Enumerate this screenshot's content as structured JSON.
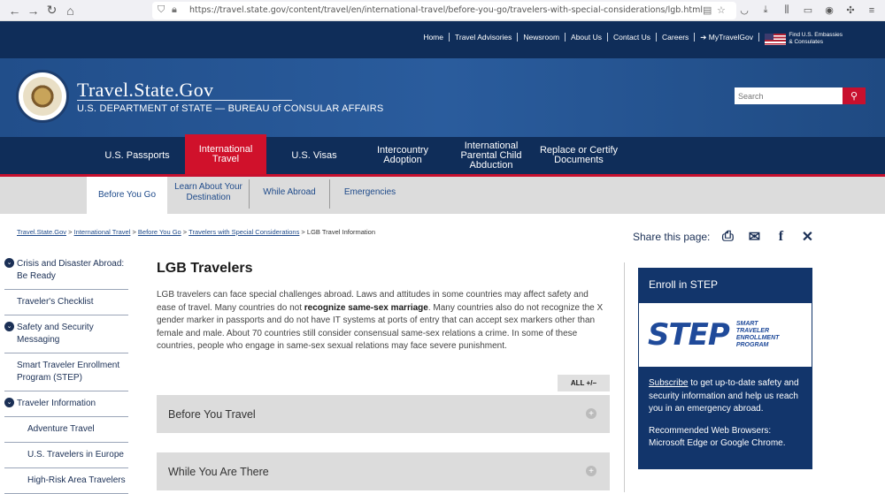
{
  "browser": {
    "url": "https://travel.state.gov/content/travel/en/international-travel/before-you-go/travelers-with-special-considerations/lgb.html"
  },
  "utility": {
    "links": [
      "Home",
      "Travel Advisories",
      "Newsroom",
      "About Us",
      "Contact Us",
      "Careers",
      "MyTravelGov"
    ],
    "embassy_line1": "Find U.S. Embassies",
    "embassy_line2": "& Consulates"
  },
  "header": {
    "title": "Travel.State.Gov",
    "subtitle": "U.S. DEPARTMENT of STATE — BUREAU of CONSULAR AFFAIRS",
    "search_placeholder": "Search"
  },
  "main_nav": [
    {
      "label": "U.S. Passports"
    },
    {
      "label": "International Travel"
    },
    {
      "label": "U.S. Visas"
    },
    {
      "label": "Intercountry Adoption"
    },
    {
      "label": "International Parental Child Abduction"
    },
    {
      "label": "Replace or Certify Documents"
    }
  ],
  "sub_nav": [
    {
      "label": "Before You Go"
    },
    {
      "label": "Learn About Your Destination"
    },
    {
      "label": "While Abroad"
    },
    {
      "label": "Emergencies"
    }
  ],
  "breadcrumb": {
    "items": [
      "Travel.State.Gov",
      "International Travel",
      "Before You Go",
      "Travelers with Special Considerations"
    ],
    "current": "LGB Travel Information"
  },
  "share": {
    "label": "Share this page:"
  },
  "sidebar": [
    {
      "label": "Crisis and Disaster Abroad: Be Ready"
    },
    {
      "label": "Traveler's Checklist"
    },
    {
      "label": "Safety and Security Messaging"
    },
    {
      "label": "Smart Traveler Enrollment Program (STEP)"
    },
    {
      "label": "Traveler Information"
    },
    {
      "label": "Adventure Travel"
    },
    {
      "label": "U.S. Travelers in Europe"
    },
    {
      "label": "High-Risk Area Travelers"
    }
  ],
  "article": {
    "title": "LGB Travelers",
    "p_part1": "LGB travelers can face special challenges abroad. Laws and attitudes in some countries may affect safety and ease of travel. Many countries do not ",
    "p_bold": "recognize same-sex marriage",
    "p_part2": ". Many countries also do not recognize the X gender marker in passports and do not have IT systems at ports of entry that can accept sex markers other than female and male. About 70 countries still consider consensual same-sex relations a crime. In some of these countries, people who engage in same-sex sexual relations may face severe punishment.",
    "all_label": "ALL +/−",
    "accordions": [
      {
        "label": "Before You Travel"
      },
      {
        "label": "While You Are There"
      }
    ]
  },
  "step": {
    "heading": "Enroll in STEP",
    "logo_big": "STEP",
    "logo_l1": "SMART",
    "logo_l2": "TRAVELER",
    "logo_l3": "ENROLLMENT",
    "logo_l4": "PROGRAM",
    "subscribe": "Subscribe",
    "body1": " to get up-to-date safety and security information and help us reach you in an emergency abroad.",
    "body2": "Recommended Web Browsers: Microsoft Edge or Google Chrome."
  }
}
